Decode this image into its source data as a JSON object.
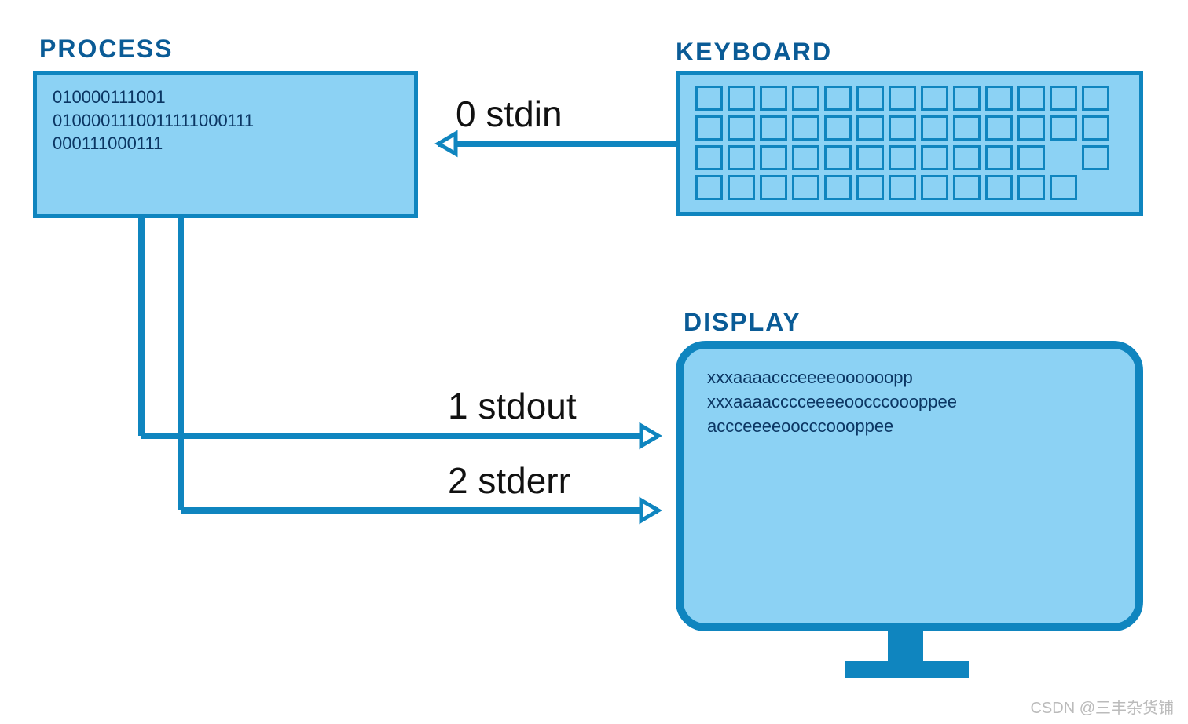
{
  "titles": {
    "process": "PROCESS",
    "keyboard": "KEYBOARD",
    "display": "DISPLAY"
  },
  "process": {
    "line1": "010000111001",
    "line2": "0100001110011111000111",
    "line3": "000111000111"
  },
  "display": {
    "line1": "xxxaaaaccceeeeoooooopp",
    "line2": "xxxaaaacccceeeeoocccoooppee",
    "line3": "accceeeeoocccoooppee"
  },
  "arrows": {
    "stdin": "0 stdin",
    "stdout": "1 stdout",
    "stderr": "2 stderr"
  },
  "keyboard": {
    "rows": [
      13,
      13,
      13,
      12
    ]
  },
  "watermark": "CSDN @三丰杂货铺"
}
